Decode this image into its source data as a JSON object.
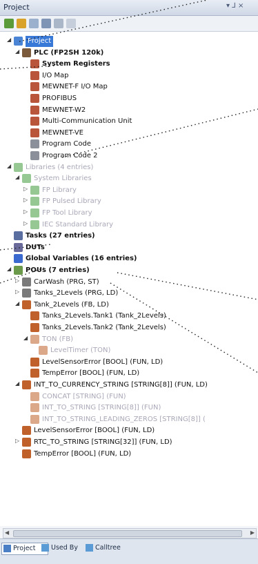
{
  "panel": {
    "title": "Project",
    "pin": "▾ ⅃ ×"
  },
  "tree": [
    {
      "label": "Project",
      "level": 0,
      "expander": "◢",
      "icon": "project",
      "style": "selected"
    },
    {
      "label": "PLC (FP2SH 120k)",
      "level": 1,
      "expander": "◢",
      "icon": "plc",
      "style": "bold"
    },
    {
      "label": "System Registers",
      "level": 2,
      "expander": "",
      "icon": "reg",
      "style": "bold"
    },
    {
      "label": "I/O Map",
      "level": 2,
      "expander": "",
      "icon": "reg",
      "style": ""
    },
    {
      "label": "MEWNET-F I/O Map",
      "level": 2,
      "expander": "",
      "icon": "reg",
      "style": ""
    },
    {
      "label": "PROFIBUS",
      "level": 2,
      "expander": "",
      "icon": "reg",
      "style": ""
    },
    {
      "label": "MEWNET-W2",
      "level": 2,
      "expander": "",
      "icon": "reg",
      "style": ""
    },
    {
      "label": "Multi-Communication Unit",
      "level": 2,
      "expander": "",
      "icon": "reg",
      "style": ""
    },
    {
      "label": "MEWNET-VE",
      "level": 2,
      "expander": "",
      "icon": "reg",
      "style": ""
    },
    {
      "label": "Program Code",
      "level": 2,
      "expander": "",
      "icon": "code",
      "style": ""
    },
    {
      "label": "Program Code 2",
      "level": 2,
      "expander": "",
      "icon": "code",
      "style": ""
    },
    {
      "label": "Libraries (4 entries)",
      "level": 0,
      "expander": "◢",
      "icon": "lib",
      "style": "gray"
    },
    {
      "label": "System Libraries",
      "level": 1,
      "expander": "◢",
      "icon": "lib",
      "style": "gray"
    },
    {
      "label": "FP Library",
      "level": 2,
      "expander": "▷",
      "icon": "lib",
      "style": "gray"
    },
    {
      "label": "FP Pulsed Library",
      "level": 2,
      "expander": "▷",
      "icon": "lib",
      "style": "gray"
    },
    {
      "label": "FP Tool Library",
      "level": 2,
      "expander": "▷",
      "icon": "lib",
      "style": "gray"
    },
    {
      "label": "IEC Standard Library",
      "level": 2,
      "expander": "▷",
      "icon": "lib",
      "style": "gray"
    },
    {
      "label": "Tasks (27 entries)",
      "level": 0,
      "expander": "",
      "icon": "task",
      "style": "bold"
    },
    {
      "label": "DUTs",
      "level": 0,
      "expander": "",
      "icon": "dut",
      "style": "bold"
    },
    {
      "label": "Global Variables (16 entries)",
      "level": 0,
      "expander": "",
      "icon": "gvar",
      "style": "bold"
    },
    {
      "label": "POUs (7 entries)",
      "level": 0,
      "expander": "◢",
      "icon": "pou",
      "style": "bold"
    },
    {
      "label": "CarWash (PRG, ST)",
      "level": 1,
      "expander": "▷",
      "icon": "prg",
      "style": ""
    },
    {
      "label": "Tanks_2Levels (PRG, LD)",
      "level": 1,
      "expander": "▷",
      "icon": "prg",
      "style": ""
    },
    {
      "label": "Tank_2Levels (FB, LD)",
      "level": 1,
      "expander": "◢",
      "icon": "fb",
      "style": ""
    },
    {
      "label": "Tanks_2Levels.Tank1 (Tank_2Levels)",
      "level": 2,
      "expander": "",
      "icon": "fb",
      "style": ""
    },
    {
      "label": "Tanks_2Levels.Tank2 (Tank_2Levels)",
      "level": 2,
      "expander": "",
      "icon": "fb",
      "style": ""
    },
    {
      "label": "TON (FB)",
      "level": 2,
      "expander": "◢",
      "icon": "fb",
      "style": "gray"
    },
    {
      "label": "LevelTimer (TON)",
      "level": 3,
      "expander": "",
      "icon": "fb",
      "style": "gray"
    },
    {
      "label": "LevelSensorError [BOOL] (FUN, LD)",
      "level": 2,
      "expander": "",
      "icon": "fb",
      "style": ""
    },
    {
      "label": "TempError [BOOL] (FUN, LD)",
      "level": 2,
      "expander": "",
      "icon": "fb",
      "style": ""
    },
    {
      "label": "INT_TO_CURRENCY_STRING [STRING[8]] (FUN, LD)",
      "level": 1,
      "expander": "◢",
      "icon": "fb",
      "style": ""
    },
    {
      "label": "CONCAT [STRING] (FUN)",
      "level": 2,
      "expander": "",
      "icon": "fb",
      "style": "gray"
    },
    {
      "label": "INT_TO_STRING [STRING[8]] (FUN)",
      "level": 2,
      "expander": "",
      "icon": "fb",
      "style": "gray"
    },
    {
      "label": "INT_TO_STRING_LEADING_ZEROS [STRING[8]] (",
      "level": 2,
      "expander": "",
      "icon": "fb",
      "style": "gray"
    },
    {
      "label": "LevelSensorError [BOOL] (FUN, LD)",
      "level": 1,
      "expander": "",
      "icon": "fb",
      "style": ""
    },
    {
      "label": "RTC_TO_STRING [STRING[32]] (FUN, LD)",
      "level": 1,
      "expander": "▷",
      "icon": "fb",
      "style": ""
    },
    {
      "label": "TempError [BOOL] (FUN, LD)",
      "level": 1,
      "expander": "",
      "icon": "fb",
      "style": ""
    }
  ],
  "tabs": [
    {
      "label": "Project",
      "active": true
    },
    {
      "label": "Used By",
      "active": false
    },
    {
      "label": "Calltree",
      "active": false
    }
  ],
  "colors": {
    "selection": "#3878d6",
    "gray_text": "#a8a8b8",
    "accent": "#1a2a44"
  }
}
